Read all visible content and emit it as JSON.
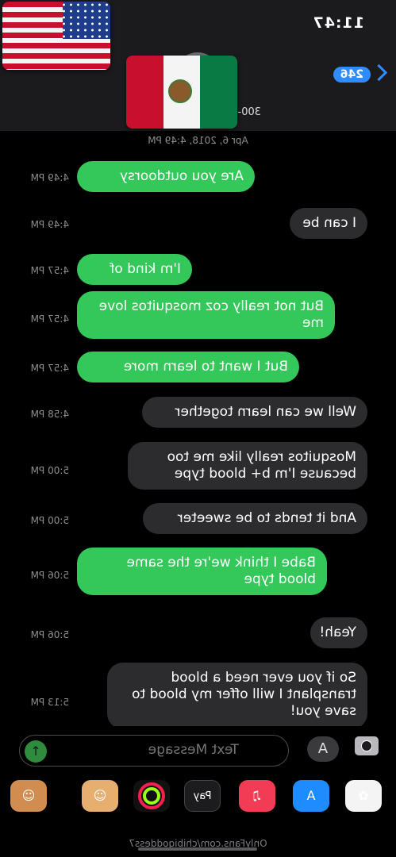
{
  "status_bar": {
    "time": "11:47"
  },
  "header": {
    "back_badge": "246",
    "contact_name": "300-",
    "flags": [
      "us-flag-emoji",
      "mexico-flag-emoji"
    ]
  },
  "date_line": "Apr 6, 2018, 4:49 PM",
  "messages": [
    {
      "text": "Are you outdoorsy",
      "time": "4:49 PM",
      "type": "sent"
    },
    {
      "text": "I can be",
      "time": "4:49 PM",
      "type": "received"
    },
    {
      "text": "I'm kind of",
      "time": "4:57 PM",
      "type": "sent"
    },
    {
      "text": "But not really coz mosquitos love me",
      "time": "4:57 PM",
      "type": "sent"
    },
    {
      "text": "But I want to learn more",
      "time": "4:57 PM",
      "type": "sent"
    },
    {
      "text": "Well we can learn together",
      "time": "4:58 PM",
      "type": "received"
    },
    {
      "text": "Mosquitos really like me too because I'm b+ blood type",
      "time": "5:00 PM",
      "type": "received"
    },
    {
      "text": "And it tends to be sweeter",
      "time": "5:00 PM",
      "type": "received"
    },
    {
      "text": "Babe I think we're the same blood type",
      "time": "5:06 PM",
      "type": "sent"
    },
    {
      "text": "Yeah!",
      "time": "5:06 PM",
      "type": "received"
    },
    {
      "text": "So if you ever need a blood transplant I will offer my blood to save you!",
      "time": "5:13 PM",
      "type": "received"
    }
  ],
  "input": {
    "placeholder": "Text Message"
  },
  "apps": {
    "apple_pay_label": "Pay",
    "items": [
      "photos-icon",
      "app-store-icon",
      "music-icon",
      "apple-pay-icon",
      "activity-icon",
      "memoji-icon",
      "memoji-icon"
    ]
  },
  "watermark": "OnlyFans.com/chibigoddess7",
  "colors": {
    "sent": "#34c759",
    "received": "#2c2c2e",
    "accent": "#2f8cff"
  }
}
